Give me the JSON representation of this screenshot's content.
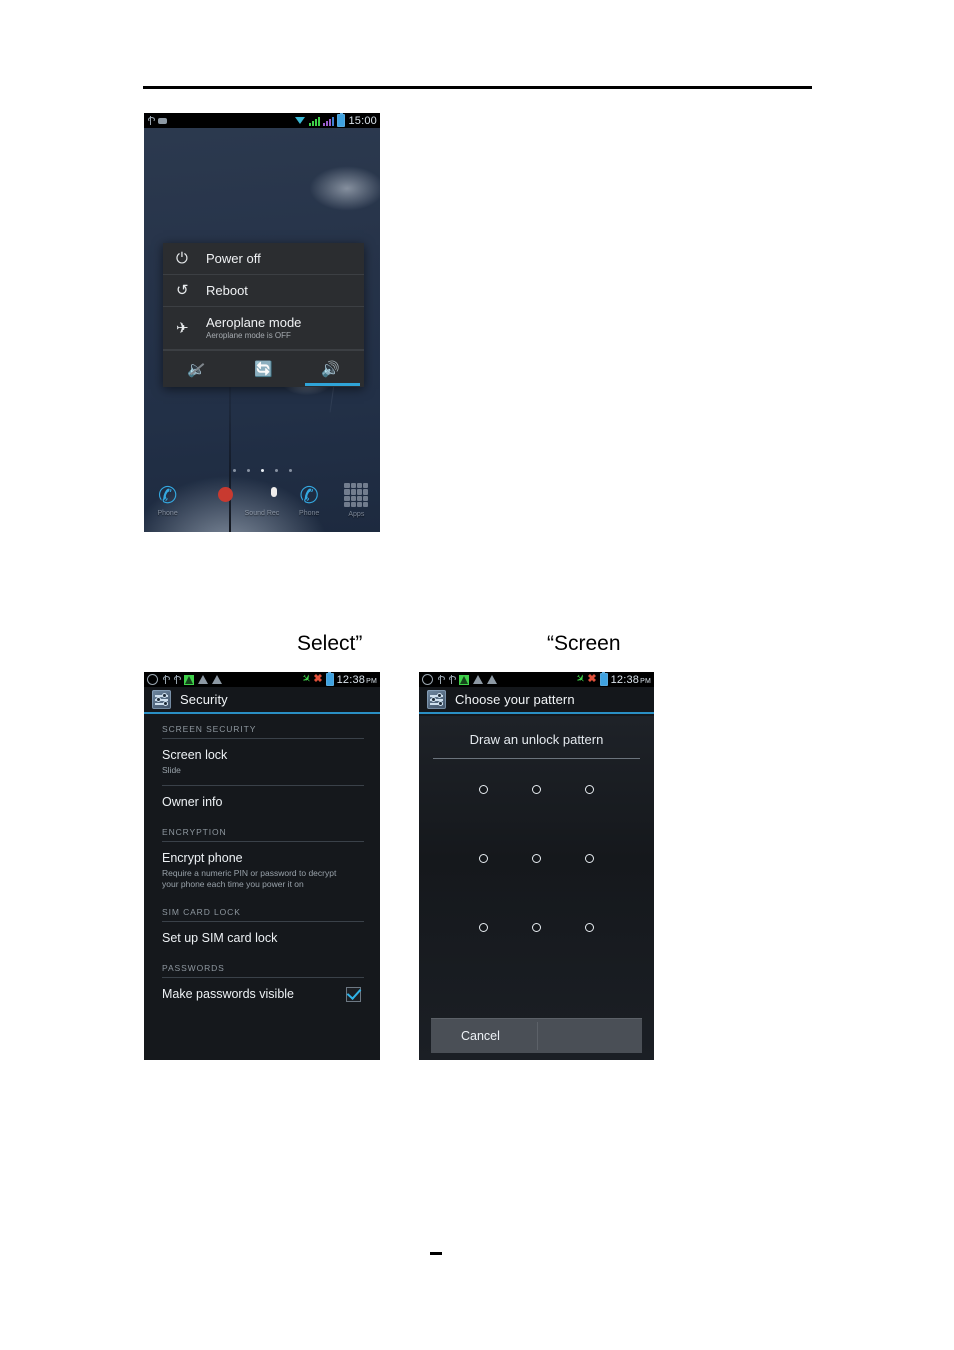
{
  "document": {
    "footer_mark": "-"
  },
  "captions": {
    "left": "Select”",
    "right": "“Screen"
  },
  "home_screen": {
    "status_bar": {
      "clock": "15:00",
      "left_icons": [
        "usb-icon",
        "chip-icon"
      ],
      "right_icons": [
        "wifi-icon",
        "signal-bars-green-icon",
        "signal-bars-purple-icon",
        "battery-icon"
      ]
    },
    "power_dialog": {
      "items": [
        {
          "icon": "power-icon",
          "label": "Power off",
          "sub": ""
        },
        {
          "icon": "reboot-icon",
          "label": "Reboot",
          "sub": ""
        },
        {
          "icon": "aeroplane-icon",
          "label": "Aeroplane mode",
          "sub": "Aeroplane mode is OFF"
        }
      ],
      "toggles": [
        {
          "icon": "mute-icon",
          "active": false
        },
        {
          "icon": "rotation-icon",
          "active": false
        },
        {
          "icon": "sound-icon",
          "active": true
        }
      ],
      "accent": "#2fa4d8"
    },
    "dock": [
      {
        "icon": "phone-icon",
        "label": "Phone"
      },
      {
        "icon": "contact-icon",
        "label": ""
      },
      {
        "icon": "sound-recorder-icon",
        "label": "Sound Rec"
      },
      {
        "icon": "phone-icon",
        "label": "Phone"
      },
      {
        "icon": "apps-icon",
        "label": "Apps"
      }
    ]
  },
  "security_screen": {
    "status_bar": {
      "clock": "12:38",
      "ampm": "PM"
    },
    "title": "Security",
    "sections": [
      {
        "header": "SCREEN SECURITY",
        "items": [
          {
            "title": "Screen lock",
            "sub": "Slide",
            "checkbox": null
          },
          {
            "title": "Owner info",
            "sub": "",
            "checkbox": null
          }
        ]
      },
      {
        "header": "ENCRYPTION",
        "items": [
          {
            "title": "Encrypt phone",
            "sub": "Require a numeric PIN or password to decrypt your phone each time you power it on",
            "checkbox": null
          }
        ]
      },
      {
        "header": "SIM CARD LOCK",
        "items": [
          {
            "title": "Set up SIM card lock",
            "sub": "",
            "checkbox": null
          }
        ]
      },
      {
        "header": "PASSWORDS",
        "items": [
          {
            "title": "Make passwords visible",
            "sub": "",
            "checkbox": true
          }
        ]
      }
    ]
  },
  "pattern_screen": {
    "status_bar": {
      "clock": "12:38",
      "ampm": "PM"
    },
    "title": "Choose your pattern",
    "prompt": "Draw an unlock pattern",
    "dots": 9,
    "cancel_label": "Cancel"
  }
}
